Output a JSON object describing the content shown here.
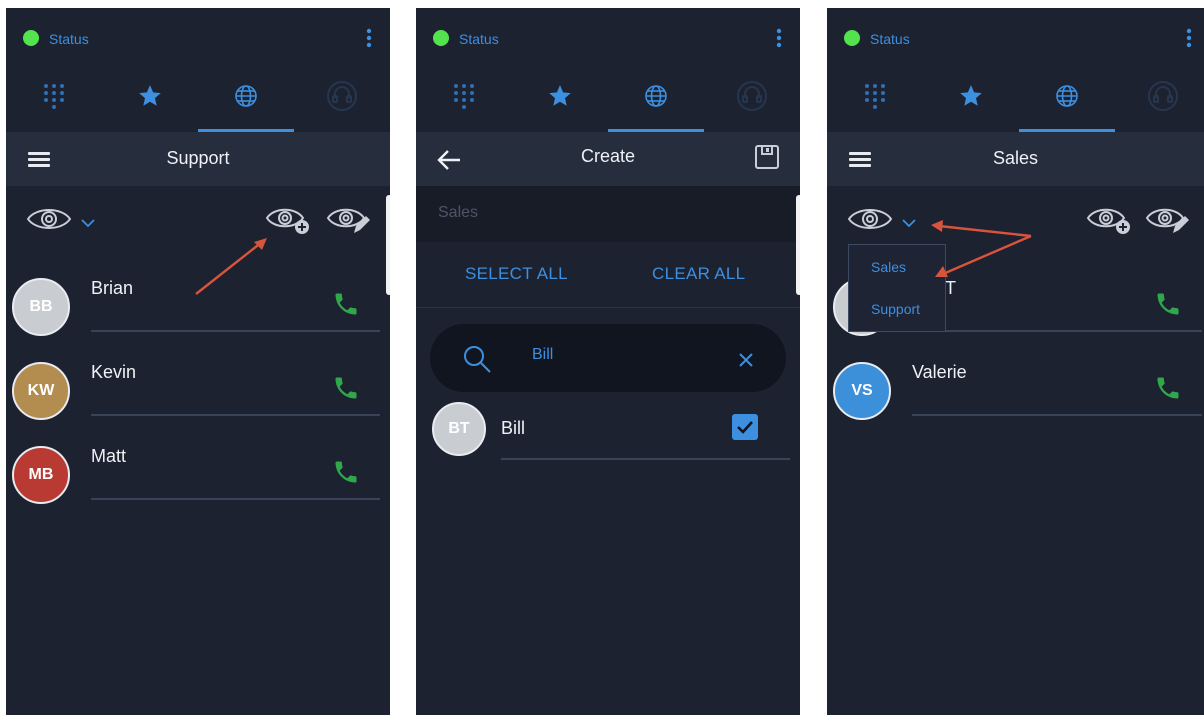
{
  "colors": {
    "accent": "#3d8fe0",
    "status_green": "#52e34d",
    "call_green": "#2ea84a",
    "annotation_arrow": "#d9543c"
  },
  "icons": {
    "tabs": [
      "dialpad-icon",
      "star-icon",
      "globe-icon",
      "headset-icon"
    ],
    "call": "phone-icon"
  },
  "panel1": {
    "status": "Status",
    "title": "Support",
    "contacts": [
      {
        "initials": "BB",
        "name": "Brian",
        "avatar_color": "#c9ccd1"
      },
      {
        "initials": "KW",
        "name": "Kevin",
        "avatar_color": "#b38c4f"
      },
      {
        "initials": "MB",
        "name": "Matt",
        "avatar_color": "#b83a33"
      }
    ]
  },
  "panel2": {
    "status": "Status",
    "title": "Create",
    "name_placeholder": "Sales",
    "select_all": "SELECT ALL",
    "clear_all": "CLEAR ALL",
    "search_value": "Bill",
    "results": [
      {
        "initials": "BT",
        "name": "Bill",
        "checked": true,
        "avatar_color": "#c9ccd1"
      }
    ]
  },
  "panel3": {
    "status": "Status",
    "title": "Sales",
    "dropdown_options": [
      "Sales",
      "Support"
    ],
    "partial_contact_suffix": "T",
    "contacts": [
      {
        "initials": "VS",
        "name": "Valerie",
        "avatar_color": "#3c8fd9"
      }
    ]
  }
}
